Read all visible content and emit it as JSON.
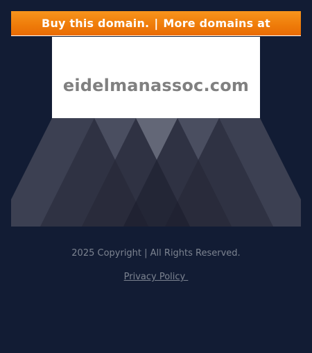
{
  "banner": {
    "left_text": "Buy this domain.",
    "separator": "|",
    "right_text": "More domains at"
  },
  "domain": {
    "name": "eidelmanassoc.com"
  },
  "footer": {
    "copyright": "2025 Copyright | All Rights Reserved.",
    "privacy_label": "Privacy Policy "
  },
  "colors": {
    "background": "#121c34",
    "banner_orange": "#ef7d0a",
    "domain_text": "#808080",
    "footer_text": "#7c8390"
  }
}
